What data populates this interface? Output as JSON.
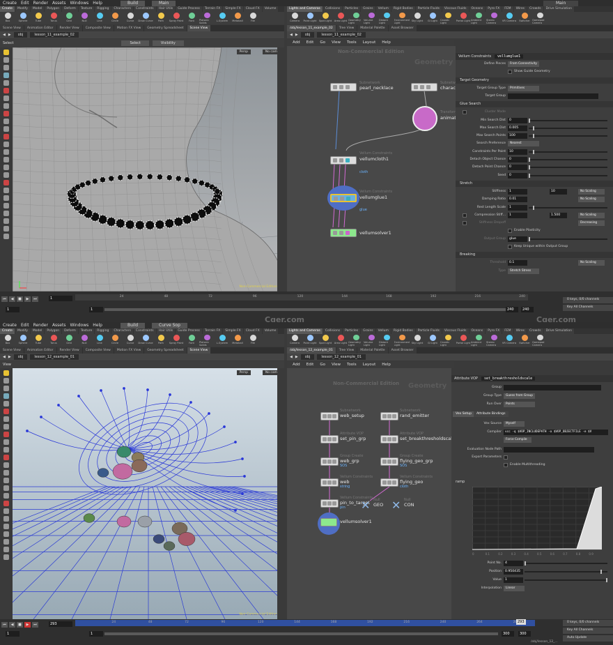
{
  "watermark": "Cger.com",
  "top": {
    "menu": [
      "Create",
      "Edit",
      "Render",
      "Assets",
      "Windows",
      "Help"
    ],
    "desktop": "Build",
    "desktop2": "Main",
    "shelf_tabs": [
      "Create",
      "Modify",
      "Model",
      "Polygon",
      "Deform",
      "Texture",
      "Rigging",
      "Characters",
      "Constraints",
      "Hair Utils",
      "Guide Process",
      "Terrain FX",
      "Simple FX",
      "Cloud FX",
      "Volume"
    ],
    "tools": [
      "Box",
      "Sphere",
      "Tube",
      "Torus",
      "Grid",
      "Null",
      "Line",
      "Circle",
      "Curve",
      "Draw Curve",
      "Path",
      "Spray Paint",
      "Font",
      "Platonic Solids",
      "L-System",
      "Metaball",
      "File"
    ],
    "lights_tabs": [
      "Lights and Cameras",
      "Collisions",
      "Particles",
      "Grains",
      "Vellum",
      "Rigid Bodies",
      "Particle Fluids",
      "Viscous Fluids",
      "Oceans",
      "Pyro FX",
      "FEM",
      "Wires",
      "Crowds",
      "Drive Simulation"
    ],
    "light_tools": [
      "Camera",
      "Point Light",
      "Spot Light",
      "Area Light",
      "Geometry Light",
      "Volume Light",
      "Distant Light",
      "Environment Light",
      "Sky Light",
      "GI Light",
      "Caustic Light",
      "Portal Light",
      "Ambient Light",
      "Stereo Camera",
      "VR Camera",
      "Switcher",
      "Gamepad Camera"
    ],
    "pane_tabs": [
      "Scene View",
      "Animation Editor",
      "Render View",
      "Composite View",
      "Motion FX View",
      "Geometry Spreadsheet",
      "Scene View"
    ],
    "net_tabs": [
      "/obj/lesson_11_example_02",
      "Tree View",
      "Material Palette",
      "Asset Browser"
    ],
    "path_left": [
      "obj",
      "lesson_11_example_02"
    ],
    "path_right": [
      "obj",
      "lesson_11_example_02"
    ],
    "vp_select": "Select",
    "vp_mode": "Select",
    "vp_vis": "Visibility",
    "persp": "Persp",
    "nocam": "No cam",
    "nce": "Non-Commercial Edition",
    "net_menu": [
      "Add",
      "Edit",
      "Go",
      "View",
      "Tools",
      "Layout",
      "Help"
    ],
    "net_nce": "Non-Commercial Edition",
    "net_geo": "Geometry",
    "nodes": {
      "pearl_type": "Subnetwork",
      "pearl": "pearl_necklace",
      "char_type": "Subnetwork",
      "char": "character",
      "anim_type": "Transform",
      "anim": "animate",
      "cloth_type": "Vellum Constraints",
      "cloth": "vellumcloth1",
      "cloth_flag": "cloth",
      "glue_type": "Vellum Constraints",
      "glue": "vellumglue1",
      "glue_flag": "glue",
      "solver": "vellumsolver1"
    },
    "params": {
      "type": "Vellum Constraints",
      "name": "vellumglue1",
      "rows": [
        {
          "k": "define",
          "label": "Define Pieces",
          "dd": "From Connectivity"
        },
        {
          "k": "guide",
          "label": "Show Guide Geometry"
        },
        {
          "k": "sec_tg",
          "label": "Target Geometry"
        },
        {
          "k": "tgtype",
          "label": "Target Group Type",
          "dd": "Primitives"
        },
        {
          "k": "tg",
          "label": "Target Group"
        },
        {
          "k": "sec_gs",
          "label": "Glue Search"
        },
        {
          "k": "cmode",
          "label": "Cluster Mode"
        },
        {
          "k": "minsd",
          "label": "Min Search Dist",
          "val": "0"
        },
        {
          "k": "maxsd",
          "label": "Max Search Dist",
          "val": "0.005"
        },
        {
          "k": "maxsp",
          "label": "Max Search Points",
          "val": "100"
        },
        {
          "k": "spref",
          "label": "Search Preference",
          "dd": "Nearest"
        },
        {
          "k": "cpp",
          "label": "Constraints Per Point",
          "val": "10"
        },
        {
          "k": "doc",
          "label": "Detach Object Chance",
          "val": "0"
        },
        {
          "k": "dpc",
          "label": "Detach Point Chance",
          "val": "0"
        },
        {
          "k": "seed",
          "label": "Seed",
          "val": "0"
        },
        {
          "k": "sec_st",
          "label": "Stretch"
        },
        {
          "k": "stiff",
          "label": "Stiffness",
          "val": "1",
          "val2": "10",
          "dd2": "No Scaling"
        },
        {
          "k": "damp",
          "label": "Damping Ratio",
          "val": "0.01",
          "dd2": "No Scaling"
        },
        {
          "k": "rest",
          "label": "Rest Length Scale",
          "val": "1"
        },
        {
          "k": "comp",
          "label": "Compression Stiff...",
          "val": "1",
          "val2": "1.500",
          "dd2": "No Scaling"
        },
        {
          "k": "sdrop",
          "label": "Stiffness Dropoff",
          "dd2": "Decreasing"
        },
        {
          "k": "plast",
          "label": "Enable Plasticity"
        },
        {
          "k": "ogrp",
          "label": "Output Group",
          "val": "glue"
        },
        {
          "k": "keep",
          "label": "Keep Unique within Output Group"
        },
        {
          "k": "sec_br",
          "label": "Breaking"
        },
        {
          "k": "thr",
          "label": "Threshold",
          "val": "0.1",
          "dd2": "No Scaling"
        },
        {
          "k": "btype",
          "label": "Type",
          "dd": "Stretch Stress"
        }
      ]
    },
    "timeline": {
      "frame": "1",
      "start": "1",
      "end1": "1",
      "ticks": [
        "24",
        "48",
        "72",
        "96",
        "120",
        "144",
        "168",
        "192",
        "216",
        "240"
      ],
      "end": "240",
      "end2": "240",
      "keys": "0 keys, 0/0 channels",
      "keyall": "Key All Channels"
    }
  },
  "bottom": {
    "menu": [
      "Create",
      "Edit",
      "Render",
      "Assets",
      "Windows",
      "Help"
    ],
    "desktop": "Build",
    "sop": "Curve Sop",
    "pane_tabs": [
      "Scene View",
      "Animation Editor",
      "Render View",
      "Composite View",
      "Motion FX View",
      "Geometry Spreadsheet",
      "Scene View"
    ],
    "net_tabs": [
      "/obj/lesson_12_example_01",
      "Tree View",
      "Material Palette",
      "Asset Browser"
    ],
    "path_left": [
      "obj",
      "lesson_12_example_01"
    ],
    "path_right": [
      "obj",
      "lesson_12_example_01"
    ],
    "vp_select": "View",
    "persp": "Persp",
    "nocam": "No cam",
    "nce": "Non-Commercial Edition",
    "net_menu": [
      "Add",
      "Edit",
      "Go",
      "View",
      "Tools",
      "Layout",
      "Help"
    ],
    "net_nce": "Non-Commercial Edition",
    "net_geo": "Geometry",
    "nodes": [
      {
        "n": "web_setup",
        "t": "Subnetwork",
        "f": ""
      },
      {
        "n": "rand_emitter",
        "t": "Subnetwork",
        "f": ""
      },
      {
        "n": "set_pin_grp",
        "t": "Attribute VOP",
        "f": ""
      },
      {
        "n": "set_breakthresholdscale",
        "t": "Attribute VOP",
        "f": ""
      },
      {
        "n": "web_grp",
        "t": "Group Create",
        "f": "SOS"
      },
      {
        "n": "flying_geo_grp",
        "t": "Group Create",
        "f": "SOS"
      },
      {
        "n": "web",
        "t": "Vellum Constraints",
        "f": "string"
      },
      {
        "n": "flying_geo",
        "t": "Vellum Constraints",
        "f": "cloth"
      },
      {
        "n": "pin_to_target",
        "t": "Vellum Constraints",
        "f": "pin"
      },
      {
        "n": "GEO",
        "t": "Null",
        "f": ""
      },
      {
        "n": "CON",
        "t": "Null",
        "f": ""
      },
      {
        "n": "vellumsolver1",
        "t": "",
        "f": ""
      }
    ],
    "params": {
      "type": "Attribute VOP",
      "name": "set_breakthresholdscale",
      "group": "Group",
      "grouptype_l": "Group Type",
      "grouptype": "Guess from Group",
      "runover_l": "Run Over",
      "runover": "Points",
      "tabs": [
        "Vex Setup",
        "Attribute Bindings"
      ],
      "vexsrc_l": "Vex Source",
      "vexsrc": "Myself",
      "compiler_l": "Compiler",
      "compiler": "vcc -q $VOP_INCLUDEPATH -o $VOP_OBJECTFILE -e $V",
      "force": "Force Compile",
      "evalpath": "Evaluation Node Path",
      "export": "Export Parameters",
      "multithread": "Enable Multithreading",
      "ramp": "ramp",
      "pointno_l": "Point No.",
      "pointno": "4",
      "position_l": "Position",
      "position": "0.950435",
      "value_l": "Value",
      "value": "1",
      "interp_l": "Interpolation",
      "interp": "Linear",
      "ramp_ticks": [
        "0",
        "0.1",
        "0.2",
        "0.3",
        "0.4",
        "0.5",
        "0.6",
        "0.7",
        "0.8",
        "0.9",
        "1"
      ]
    },
    "timeline": {
      "frame": "293",
      "start": "1",
      "end1": "1",
      "ticks": [
        "24",
        "48",
        "72",
        "96",
        "120",
        "144",
        "168",
        "192",
        "216",
        "240",
        "264",
        "288"
      ],
      "cur": "293",
      "end": "300",
      "end2": "300",
      "keys": "0 keys, 0/0 channels",
      "keyall": "Key All Channels",
      "auto": "Auto Update",
      "path": "/obj/lesson_12_..."
    }
  }
}
